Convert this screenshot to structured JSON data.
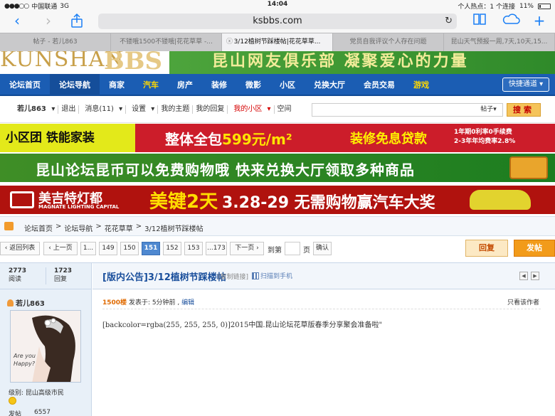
{
  "status": {
    "carrier": "中国联通",
    "network": "3G",
    "time": "14:04",
    "hotspot": "个人热点：1 个连接",
    "battery": "11%"
  },
  "browser": {
    "url": "ksbbs.com"
  },
  "tabs": [
    {
      "label": "帖子 - 若儿863"
    },
    {
      "label": "不镂哦1500不镂哦|花花草草 -..."
    },
    {
      "label": "3/12植树节踩楼帖|花花草草..."
    },
    {
      "label": "党员自我评议个人存在问题"
    },
    {
      "label": "昆山天气预报一周,7天,10天,15..."
    }
  ],
  "banner": {
    "logo_text": "KUNSHAN",
    "logo_bbs": "BBS",
    "slogan": "昆山网友俱乐部  凝聚爱心的力量"
  },
  "nav": {
    "items": [
      "论坛首页",
      "论坛导航",
      "商家",
      "汽车",
      "房产",
      "装修",
      "微影",
      "小区",
      "兑换大厅",
      "会员交易",
      "游戏"
    ],
    "quick": "快捷通道"
  },
  "userbar": {
    "username": "若儿863",
    "links": [
      "退出",
      "消息(11)",
      "设置",
      "我的主题",
      "我的回复",
      "我的小区",
      "空间"
    ],
    "search_select": "帖子",
    "search_button": "搜索"
  },
  "ads": {
    "ad1_brand": "小区团 铁能家装",
    "ad1_main": "整体全包",
    "ad1_price": "599元/m²",
    "ad1_loan": "装修免息贷款",
    "ad1_note1": "1年期0利率0手续费",
    "ad1_note2": "2-3年年均费率2.8%",
    "ad2_text": "昆山论坛昆币可以免费购物哦  快来兑换大厅领取多种商品",
    "ad3_brand": "美吉特灯都",
    "ad3_brand_en": "MAGNATE LIGHTING CAPITAL",
    "ad3_days": "美键2天",
    "ad3_text": "3.28-29 无需购物赢汽车大奖"
  },
  "breadcrumb": [
    "论坛首页",
    ">",
    "论坛导航",
    ">",
    "花花草草",
    ">",
    "3/12植树节踩楼帖"
  ],
  "pager": {
    "back": "返回列表",
    "prev": "上一页",
    "pages": [
      "1...",
      "149",
      "150",
      "151",
      "152",
      "153",
      "...173"
    ],
    "current": "151",
    "next": "下一页",
    "goto_label": "到第",
    "page_label": "页",
    "confirm": "确认",
    "reply": "回复",
    "post": "发帖"
  },
  "post": {
    "views": "2773",
    "views_label": "阅读",
    "replies": "1723",
    "replies_label": "回复",
    "title": "[版内公告]3/12植树节踩楼帖",
    "copy_link": "[复制链接]",
    "scan": "扫描到手机",
    "author": "若儿863",
    "avatar_text": "Are you Happy?",
    "level": "级别: 昆山高级市民",
    "posts_label": "发帖",
    "posts_count": "6557",
    "floor": "1500楼",
    "posted": "发表于: 5分钟前 , ",
    "edit": "编辑",
    "only_author": "只看该作者",
    "content": "[backcolor=rgba(255, 255, 255, 0)]2015中国.昆山论坛花草版春季分享聚会准备啦\""
  }
}
